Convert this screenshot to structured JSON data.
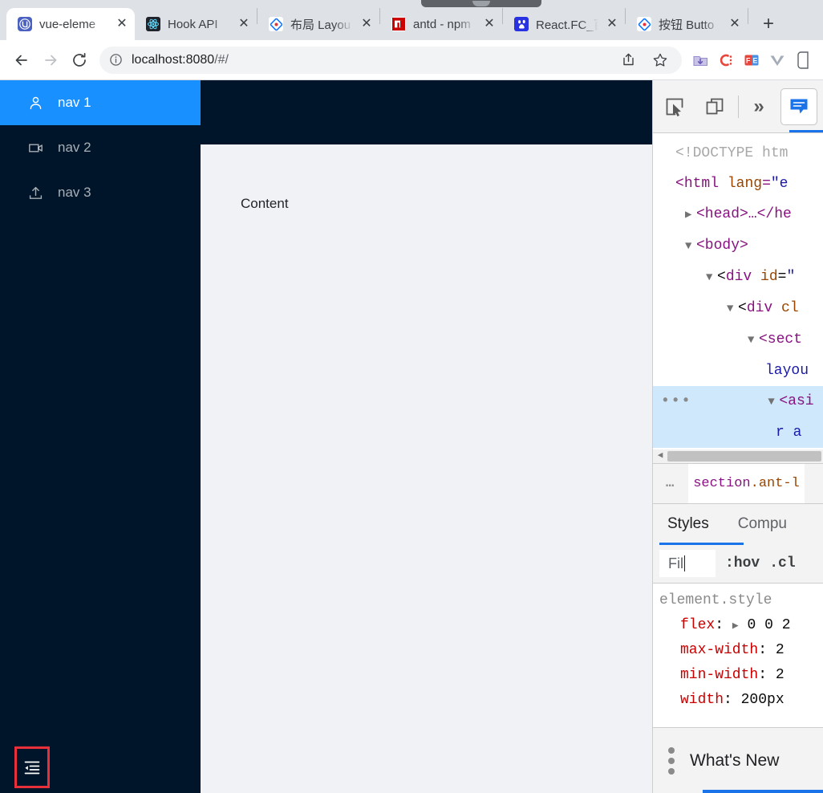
{
  "browser": {
    "tabs": [
      {
        "title": "vue-eleme",
        "favicon": "vue-element-admin-icon",
        "active": true,
        "close_label": "✕"
      },
      {
        "title": "Hook API",
        "favicon": "react-icon",
        "active": false,
        "close_label": "✕"
      },
      {
        "title": "布局 Layou",
        "favicon": "antdesign-icon",
        "active": false,
        "close_label": "✕"
      },
      {
        "title": "antd - npm",
        "favicon": "npm-icon",
        "active": false,
        "close_label": "✕"
      },
      {
        "title": "React.FC_百",
        "favicon": "baidu-icon",
        "active": false,
        "close_label": "✕"
      },
      {
        "title": "按钮 Butto",
        "favicon": "antdesign-icon",
        "active": false,
        "close_label": "✕"
      }
    ],
    "new_tab_label": "+",
    "toolbar": {
      "back_icon": "back-arrow-icon",
      "forward_icon": "forward-arrow-icon",
      "reload_icon": "reload-icon",
      "site_info_icon": "info-circle-icon",
      "url": "localhost:8080",
      "url_path": "/#/",
      "url_full": "localhost:8080/#/",
      "share_icon": "share-icon",
      "bookmark_icon": "star-icon",
      "extensions": [
        {
          "name": "download-manager-icon",
          "color": "#9b8bd0"
        },
        {
          "name": "c-extension-icon",
          "color": "#e8453c"
        },
        {
          "name": "fe-extension-icon",
          "color": "#e8453c"
        },
        {
          "name": "vue-devtools-icon",
          "color": "#a3acb8"
        },
        {
          "name": "extension-partial-icon",
          "color": "#5f6368"
        }
      ]
    }
  },
  "page": {
    "sider": {
      "items": [
        {
          "label": "nav 1",
          "icon": "user-icon",
          "selected": true
        },
        {
          "label": "nav 2",
          "icon": "video-camera-icon",
          "selected": false
        },
        {
          "label": "nav 3",
          "icon": "upload-icon",
          "selected": false
        }
      ],
      "collapse_button": {
        "icon": "menu-fold-icon",
        "highlight_color": "#e8303a"
      }
    },
    "content": {
      "text": "Content"
    },
    "colors": {
      "sider_bg": "#001529",
      "selected_bg": "#1890ff",
      "content_bg": "#f0f2f5"
    }
  },
  "devtools": {
    "toolbar": {
      "inspect_icon": "inspect-element-icon",
      "device_toolbar_icon": "device-toolbar-icon",
      "more_panels_label": "»",
      "active_panel_icon": "elements-panel-icon"
    },
    "dom_tree": [
      {
        "indent": 0,
        "triangle": "",
        "text": "<!DOCTYPE htm",
        "kind": "doctype"
      },
      {
        "indent": 0,
        "triangle": "",
        "text": "<html lang=\"e",
        "kind": "element"
      },
      {
        "indent": 1,
        "triangle": "▶",
        "text": "<head>…</he",
        "kind": "element"
      },
      {
        "indent": 1,
        "triangle": "▼",
        "text": "<body>",
        "kind": "element"
      },
      {
        "indent": 2,
        "triangle": "▼",
        "text": "<div id=\"",
        "kind": "element"
      },
      {
        "indent": 3,
        "triangle": "▼",
        "text": "<div cl",
        "kind": "element"
      },
      {
        "indent": 4,
        "triangle": "▼",
        "text": "<sect",
        "kind": "element"
      },
      {
        "indent": 5,
        "triangle": "",
        "text": "layou",
        "kind": "attrvalue"
      },
      {
        "indent": 4,
        "triangle": "▼",
        "text": "<asi",
        "kind": "element",
        "selected": true,
        "badge": "•••"
      },
      {
        "indent": 5,
        "triangle": "",
        "text": "r a",
        "kind": "attrvalue",
        "selected": true
      }
    ],
    "dom_hscroll": {
      "left_arrow": "◀"
    },
    "breadcrumb": {
      "overflow": "…",
      "selected": "section.ant-l"
    },
    "subtabs": [
      {
        "label": "Styles",
        "active": true
      },
      {
        "label": "Compu",
        "active": false
      }
    ],
    "filter_bar": {
      "placeholder": "Fil",
      "value": "",
      "hov_label": ":hov",
      "cls_label": ".cl"
    },
    "styles": {
      "selector": "element.style",
      "declarations": [
        {
          "name": "flex",
          "value": "0 0 2",
          "expandable": true
        },
        {
          "name": "max-width",
          "value": "2",
          "expandable": false
        },
        {
          "name": "min-width",
          "value": "2",
          "expandable": false
        },
        {
          "name": "width",
          "value": "200px",
          "expandable": false
        }
      ]
    },
    "drawer": {
      "kebab_icon": "more-options-icon",
      "tab_label": "What's New"
    }
  }
}
